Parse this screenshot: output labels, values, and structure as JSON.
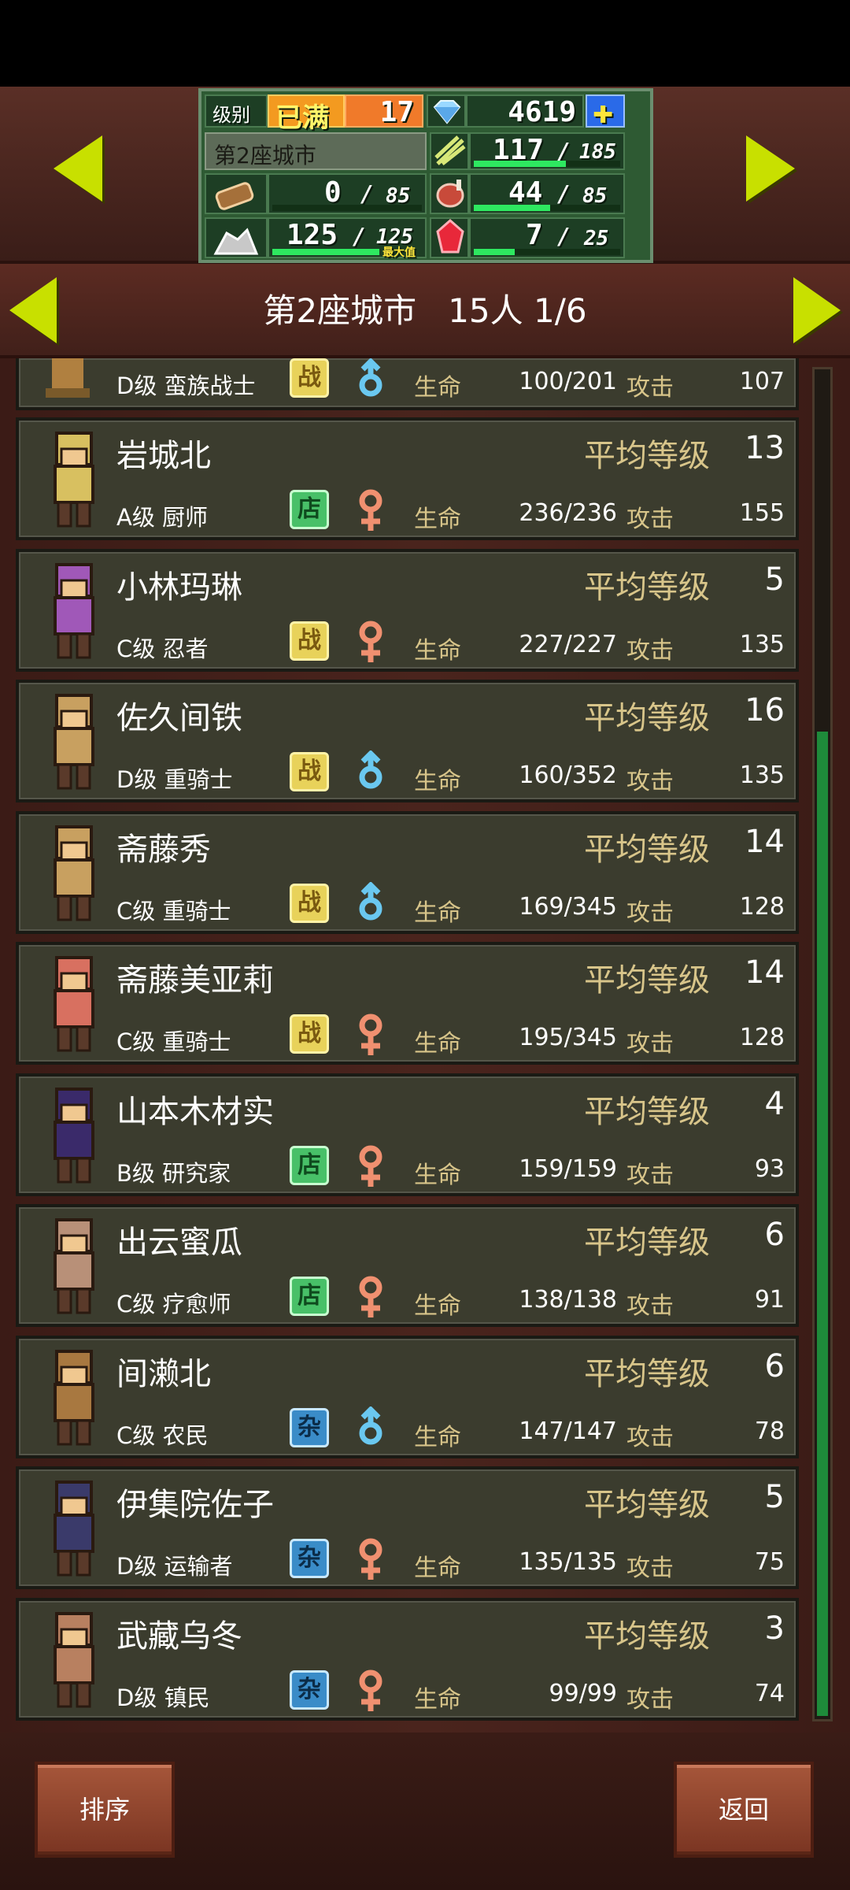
{
  "hud": {
    "level_label": "级别",
    "level_badge": "已满",
    "level_value": "17",
    "gems": "4619",
    "city_name": "第2座城市",
    "food_current": "117",
    "food_max": "185",
    "wood_current": "0",
    "wood_max": "85",
    "meat_current": "44",
    "meat_max": "85",
    "stone_current": "125",
    "stone_max": "125",
    "stone_max_tag": "最大值",
    "ruby_current": "7",
    "ruby_max": "25",
    "slash": "/",
    "food_fill": 0.63,
    "wood_fill": 0.0,
    "meat_fill": 0.52,
    "stone_fill": 1.0,
    "ruby_fill": 0.28
  },
  "title": {
    "city": "第2座城市",
    "count": "15人",
    "page": "1/6"
  },
  "labels": {
    "avg_level": "平均等级",
    "hp": "生命",
    "attack": "攻击"
  },
  "partial_row": {
    "rank_job": "D级 蛮族战士",
    "type": "战",
    "hp": "100/201",
    "attack": "107"
  },
  "residents": [
    {
      "name": "岩城北",
      "level": "13",
      "rank_job": "A级 厨师",
      "type": "店",
      "hp": "236/236",
      "attack": "155"
    },
    {
      "name": "小林玛琳",
      "level": "5",
      "rank_job": "C级 忍者",
      "type": "战",
      "hp": "227/227",
      "attack": "135"
    },
    {
      "name": "佐久间铁",
      "level": "16",
      "rank_job": "D级 重骑士",
      "type": "战",
      "hp": "160/352",
      "attack": "135"
    },
    {
      "name": "斋藤秀",
      "level": "14",
      "rank_job": "C级 重骑士",
      "type": "战",
      "hp": "169/345",
      "attack": "128"
    },
    {
      "name": "斋藤美亚莉",
      "level": "14",
      "rank_job": "C级 重骑士",
      "type": "战",
      "hp": "195/345",
      "attack": "128"
    },
    {
      "name": "山本木材实",
      "level": "4",
      "rank_job": "B级 研究家",
      "type": "店",
      "hp": "159/159",
      "attack": "93"
    },
    {
      "name": "出云蜜瓜",
      "level": "6",
      "rank_job": "C级 疗愈师",
      "type": "店",
      "hp": "138/138",
      "attack": "91"
    },
    {
      "name": "间濑北",
      "level": "6",
      "rank_job": "C级 农民",
      "type": "杂",
      "hp": "147/147",
      "attack": "78"
    },
    {
      "name": "伊集院佐子",
      "level": "5",
      "rank_job": "D级 运输者",
      "type": "杂",
      "hp": "135/135",
      "attack": "75"
    },
    {
      "name": "武藏乌冬",
      "level": "3",
      "rank_job": "D级 镇民",
      "type": "杂",
      "hp": "99/99",
      "attack": "74"
    }
  ],
  "buttons": {
    "sort": "排序",
    "back": "返回"
  },
  "colors": {
    "accent_arrow": "#c8e000",
    "hud_green": "#2e5a33",
    "panel_bg": "#3b3c2e",
    "label_gold": "#d8c58a",
    "button_brown": "#a6563a"
  }
}
